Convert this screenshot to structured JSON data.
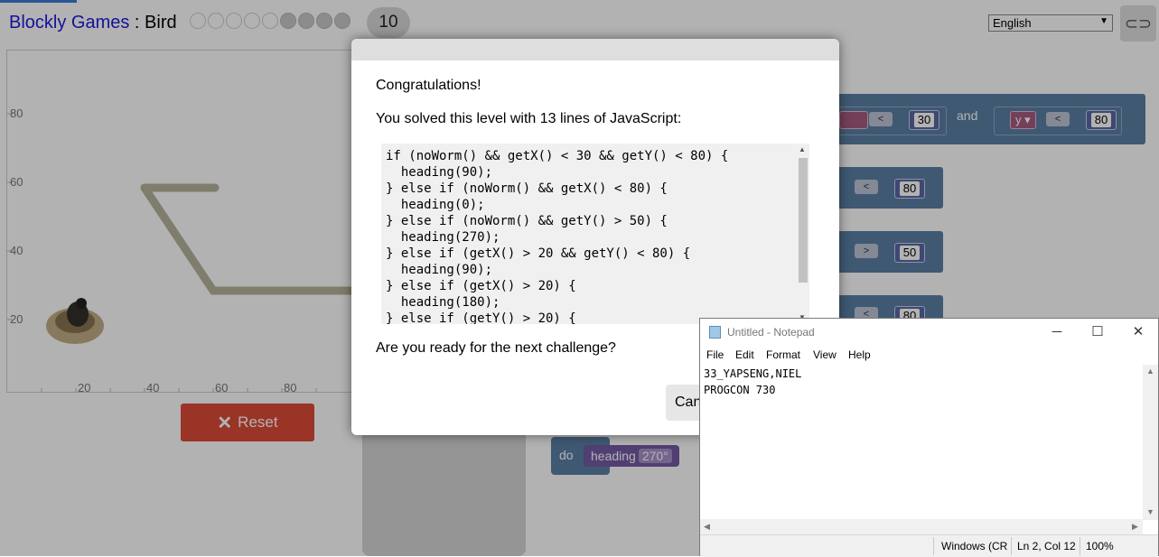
{
  "app": {
    "title_link": "Blockly Games",
    "title_sep": " : ",
    "title_game": "Bird",
    "current_level": "10",
    "language": "English"
  },
  "stage": {
    "y_ticks": [
      "80",
      "60",
      "40",
      "20"
    ],
    "x_ticks": [
      "20",
      "40",
      "60",
      "80"
    ]
  },
  "reset_label": "Reset",
  "workspace": {
    "and_label": "and",
    "y_label": "y",
    "lt": "<",
    "gt": ">",
    "v30": "30",
    "v80a": "80",
    "v80b": "80",
    "v50": "50",
    "v80c": "80",
    "do_label": "do",
    "heading_label": "heading",
    "heading_value": "270°"
  },
  "dialog": {
    "congrats": "Congratulations!",
    "solved": "You solved this level with 13 lines of JavaScript:",
    "code_lines": [
      "if (noWorm() && getX() < 30 && getY() < 80) {",
      "  heading(90);",
      "} else if (noWorm() && getX() < 80) {",
      "  heading(0);",
      "} else if (noWorm() && getY() > 50) {",
      "  heading(270);",
      "} else if (getX() > 20 && getY() < 80) {",
      "  heading(90);",
      "} else if (getX() > 20) {",
      "  heading(180);",
      "} else if (getY() > 20) {"
    ],
    "ready": "Are you ready for the next challenge?",
    "cancel_label": "Can"
  },
  "notepad": {
    "title": "Untitled - Notepad",
    "menu": [
      "File",
      "Edit",
      "Format",
      "View",
      "Help"
    ],
    "lines": [
      "33_YAPSENG,NIEL",
      "PROGCON 730"
    ],
    "status_encoding": "Windows (CR",
    "status_pos": "Ln 2, Col 12",
    "status_zoom": "100%"
  },
  "colors": {
    "reset": "#dd4b39",
    "logic_block": "#5b80a5",
    "heading_block": "#745ba5",
    "title_link": "#1a1adf"
  }
}
